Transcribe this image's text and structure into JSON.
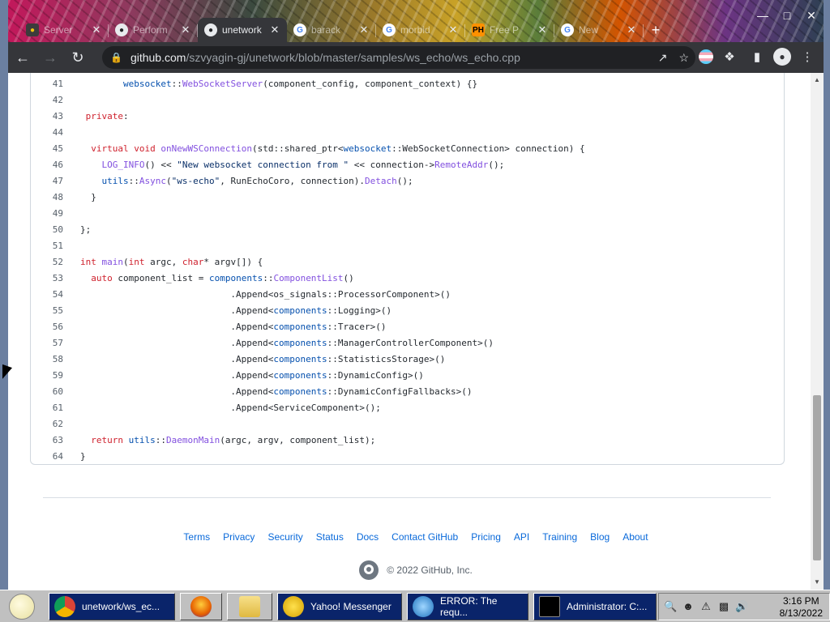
{
  "browser": {
    "tabs": [
      {
        "title": "Server",
        "favicon": "ghost-icon",
        "active": false
      },
      {
        "title": "Perform",
        "favicon": "github-icon",
        "active": false
      },
      {
        "title": "unetwork",
        "favicon": "github-icon",
        "active": true
      },
      {
        "title": "barack",
        "favicon": "google-icon",
        "active": false
      },
      {
        "title": "morbid",
        "favicon": "google-icon",
        "active": false
      },
      {
        "title": "Free P",
        "favicon": "ph-icon",
        "active": false
      },
      {
        "title": "New",
        "favicon": "google-icon",
        "active": false
      }
    ],
    "new_tab": "+",
    "url_host": "github.com",
    "url_path": "/szvyagin-gj/unetwork/blob/master/samples/ws_echo/ws_echo.cpp"
  },
  "code": {
    "lines": [
      {
        "n": "41",
        "text": "        websocket::WebSocketServer(component_config, component_context) {}"
      },
      {
        "n": "42",
        "text": ""
      },
      {
        "n": "43",
        "text": " private:"
      },
      {
        "n": "44",
        "text": ""
      },
      {
        "n": "45",
        "text": "  virtual void onNewWSConnection(std::shared_ptr<websocket::WebSocketConnection> connection) {"
      },
      {
        "n": "46",
        "text": "    LOG_INFO() << \"New websocket connection from \" << connection->RemoteAddr();"
      },
      {
        "n": "47",
        "text": "    utils::Async(\"ws-echo\", RunEchoCoro, connection).Detach();"
      },
      {
        "n": "48",
        "text": "  }"
      },
      {
        "n": "49",
        "text": ""
      },
      {
        "n": "50",
        "text": "};"
      },
      {
        "n": "51",
        "text": ""
      },
      {
        "n": "52",
        "text": "int main(int argc, char* argv[]) {"
      },
      {
        "n": "53",
        "text": "  auto component_list = components::ComponentList()"
      },
      {
        "n": "54",
        "text": "                            .Append<os_signals::ProcessorComponent>()"
      },
      {
        "n": "55",
        "text": "                            .Append<components::Logging>()"
      },
      {
        "n": "56",
        "text": "                            .Append<components::Tracer>()"
      },
      {
        "n": "57",
        "text": "                            .Append<components::ManagerControllerComponent>()"
      },
      {
        "n": "58",
        "text": "                            .Append<components::StatisticsStorage>()"
      },
      {
        "n": "59",
        "text": "                            .Append<components::DynamicConfig>()"
      },
      {
        "n": "60",
        "text": "                            .Append<components::DynamicConfigFallbacks>()"
      },
      {
        "n": "61",
        "text": "                            .Append<ServiceComponent>();"
      },
      {
        "n": "62",
        "text": ""
      },
      {
        "n": "63",
        "text": "  return utils::DaemonMain(argc, argv, component_list);"
      },
      {
        "n": "64",
        "text": "}"
      }
    ]
  },
  "footer": {
    "links": [
      "Terms",
      "Privacy",
      "Security",
      "Status",
      "Docs",
      "Contact GitHub",
      "Pricing",
      "API",
      "Training",
      "Blog",
      "About"
    ],
    "copyright": "© 2022 GitHub, Inc."
  },
  "taskbar": {
    "items": [
      {
        "label": "unetwork/ws_ec...",
        "icon": "chrome-icon"
      },
      {
        "label": "",
        "icon": "firefox-icon"
      },
      {
        "label": "",
        "icon": "folder-icon"
      },
      {
        "label": "Yahoo! Messenger",
        "icon": "yahoo-messenger-icon"
      },
      {
        "label": "ERROR: The requ...",
        "icon": "internet-explorer-icon"
      },
      {
        "label": "Administrator: C:...",
        "icon": "command-prompt-icon"
      }
    ],
    "clock_time": "3:16 PM",
    "clock_date": "8/13/2022"
  },
  "colors": {
    "link": "#0969da",
    "keyword": "#cf222e",
    "function": "#8250df",
    "string": "#0a3069"
  }
}
